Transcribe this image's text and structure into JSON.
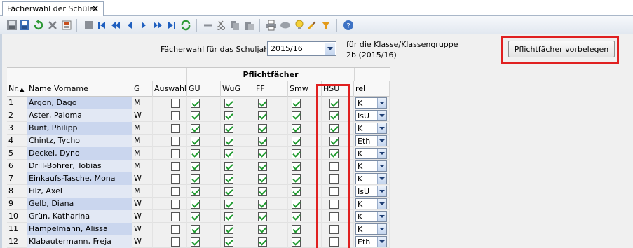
{
  "tab": {
    "title": "Fächerwahl der Schüler",
    "close": "×"
  },
  "toolbar": {
    "icons": [
      "save-disk-icon",
      "save-disk-icon",
      "undo-icon",
      "delete-icon",
      "calc-icon",
      "form-icon",
      "first-icon",
      "prev-page-icon",
      "prev-icon",
      "next-icon",
      "next-page-icon",
      "last-icon",
      "refresh-icon",
      "arrow-left-icon",
      "cut-icon",
      "copy-icon",
      "paste-icon",
      "print-icon",
      "preview-icon",
      "bulb-icon",
      "brush-icon",
      "filter-icon",
      "help-icon"
    ]
  },
  "header": {
    "year_label": "Fächerwahl für das Schuljahr",
    "year_value": "2015/16",
    "class_label": "für die Klasse/Klassengruppe",
    "class_value": "2b (2015/16)",
    "assign_button": "Pflichtfächer vorbelegen"
  },
  "grid": {
    "group_header": "Pflichtfächer",
    "columns": [
      "Nr.",
      "Name Vorname",
      "G",
      "Auswahl",
      "GU",
      "WuG",
      "FF",
      "Smw",
      "HSU",
      "rel"
    ],
    "sort_indicator": "▲",
    "rows": [
      {
        "nr": "1",
        "name": "Argon, Dago",
        "g": "M",
        "auswahl": false,
        "gu": true,
        "wug": true,
        "ff": true,
        "smw": true,
        "hsu": true,
        "rel": "K"
      },
      {
        "nr": "2",
        "name": "Aster, Paloma",
        "g": "W",
        "auswahl": false,
        "gu": true,
        "wug": true,
        "ff": true,
        "smw": true,
        "hsu": true,
        "rel": "IsU"
      },
      {
        "nr": "3",
        "name": "Bunt, Philipp",
        "g": "M",
        "auswahl": false,
        "gu": true,
        "wug": true,
        "ff": true,
        "smw": true,
        "hsu": true,
        "rel": "K"
      },
      {
        "nr": "4",
        "name": "Chintz, Tycho",
        "g": "M",
        "auswahl": false,
        "gu": true,
        "wug": true,
        "ff": true,
        "smw": true,
        "hsu": true,
        "rel": "Eth"
      },
      {
        "nr": "5",
        "name": "Deckel, Dyno",
        "g": "M",
        "auswahl": false,
        "gu": true,
        "wug": true,
        "ff": true,
        "smw": true,
        "hsu": true,
        "rel": "K"
      },
      {
        "nr": "6",
        "name": "Drill-Bohrer, Tobias",
        "g": "M",
        "auswahl": false,
        "gu": true,
        "wug": true,
        "ff": true,
        "smw": true,
        "hsu": false,
        "rel": "K"
      },
      {
        "nr": "7",
        "name": "Einkaufs-Tasche, Mona",
        "g": "W",
        "auswahl": false,
        "gu": true,
        "wug": true,
        "ff": true,
        "smw": true,
        "hsu": false,
        "rel": "K"
      },
      {
        "nr": "8",
        "name": "Filz, Axel",
        "g": "M",
        "auswahl": false,
        "gu": true,
        "wug": true,
        "ff": true,
        "smw": true,
        "hsu": false,
        "rel": "IsU"
      },
      {
        "nr": "9",
        "name": "Gelb, Diana",
        "g": "W",
        "auswahl": false,
        "gu": true,
        "wug": true,
        "ff": true,
        "smw": true,
        "hsu": false,
        "rel": "K"
      },
      {
        "nr": "10",
        "name": "Grün, Katharina",
        "g": "W",
        "auswahl": false,
        "gu": true,
        "wug": true,
        "ff": true,
        "smw": true,
        "hsu": false,
        "rel": "K"
      },
      {
        "nr": "11",
        "name": "Hampelmann, Alissa",
        "g": "W",
        "auswahl": false,
        "gu": true,
        "wug": true,
        "ff": true,
        "smw": true,
        "hsu": false,
        "rel": "K"
      },
      {
        "nr": "12",
        "name": "Klabautermann, Freja",
        "g": "W",
        "auswahl": false,
        "gu": true,
        "wug": true,
        "ff": true,
        "smw": true,
        "hsu": false,
        "rel": "Eth"
      }
    ]
  },
  "colors": {
    "highlight": "#e02020",
    "check": "#1d9a2d",
    "name_bg": "#cad6ee"
  }
}
